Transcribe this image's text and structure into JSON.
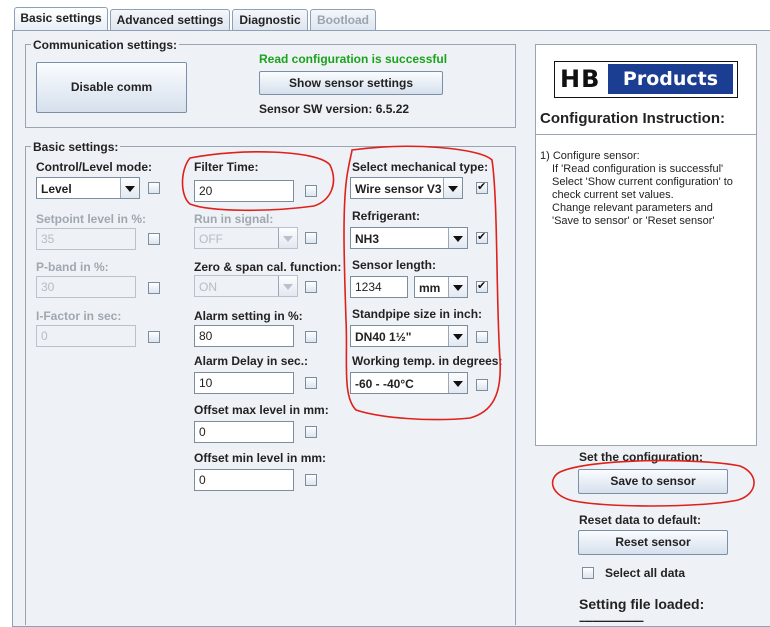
{
  "tabs": [
    {
      "label": "Basic settings",
      "state": "active"
    },
    {
      "label": "Advanced settings",
      "state": "normal"
    },
    {
      "label": "Diagnostic",
      "state": "normal"
    },
    {
      "label": "Bootload",
      "state": "disabled"
    }
  ],
  "communication": {
    "group_title": "Communication settings:",
    "disable_button": "Disable comm",
    "status": "Read configuration is successful",
    "status_color": "#1aa31a",
    "show_button": "Show sensor settings",
    "sw_version": "Sensor SW version: 6.5.22"
  },
  "basic": {
    "group_title": "Basic settings:",
    "col1": {
      "mode_label": "Control/Level mode:",
      "mode_value": "Level",
      "setpoint_label": "Setpoint level in %:",
      "setpoint_value": "35",
      "pband_label": "P-band in %:",
      "pband_value": "30",
      "ifactor_label": "I-Factor in sec:",
      "ifactor_value": "0"
    },
    "col2": {
      "filter_label": "Filter Time:",
      "filter_value": "20",
      "run_label": "Run in signal:",
      "run_value": "OFF",
      "zero_label": "Zero & span cal. function:",
      "zero_value": "ON",
      "alarm_label": "Alarm setting in %:",
      "alarm_value": "80",
      "delay_label": "Alarm Delay in sec.:",
      "delay_value": "10",
      "offmax_label": "Offset max level in mm:",
      "offmax_value": "0",
      "offmin_label": "Offset min level in mm:",
      "offmin_value": "0"
    },
    "col3": {
      "mech_label": "Select mechanical type:",
      "mech_value": "Wire sensor V3",
      "refrig_label": "Refrigerant:",
      "refrig_value": "NH3",
      "length_label": "Sensor length:",
      "length_value": "1234",
      "length_unit": "mm",
      "standpipe_label": "Standpipe size in inch:",
      "standpipe_value": "DN40 1½\"",
      "temp_label": "Working temp. in degrees:",
      "temp_value": "-60 - -40°C"
    }
  },
  "logo": {
    "hb": "HB",
    "products": "Products",
    "brand_color": "#1b3e93"
  },
  "instruction": {
    "title": "Configuration Instruction:",
    "lines": [
      "1) Configure sensor:",
      "If 'Read configuration is successful'",
      "Select 'Show current configuration' to",
      "check current set values.",
      "Change relevant parameters and",
      "'Save to sensor' or 'Reset sensor'"
    ]
  },
  "actions": {
    "set_label": "Set the configuration:",
    "save_button": "Save to sensor",
    "reset_label": "Reset data to default:",
    "reset_button": "Reset sensor",
    "select_all": "Select all data",
    "setting_file": "Setting file loaded:",
    "setting_file_value": "------------------------"
  },
  "annotation_color": "#e0201a"
}
